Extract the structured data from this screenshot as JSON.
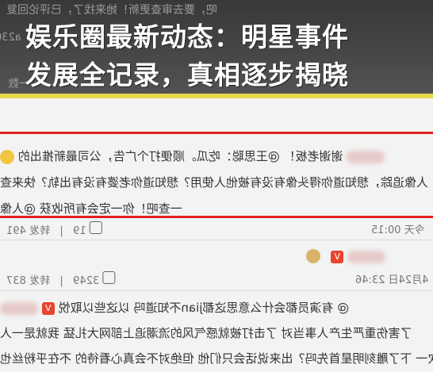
{
  "headline": {
    "line1": "娱乐圈最新动态：明星事件",
    "line2": "发展全记录，真相逐步揭晓"
  },
  "banner_ghost": {
    "top": "吧，要去审查更新！她来找了，已评论回复",
    "mid": "a230",
    "bottom": "一数"
  },
  "comments": {
    "c1_text": "谢谢老板！ @王思聪：吃瓜。顺便打个广告，公司最新推出的",
    "c1_line2": "人像追踪，想知道你得头像有没有被他人使用？想知道你老婆有没有出轨？快来查",
    "c1_line3": "一查吧！你一定会有所收获 @人像",
    "c1_time": "今天 00:15",
    "c1_reposts": "转发 491",
    "c1_likes": "19",
    "c2_time": "4月24日 23:46",
    "c2_reposts": "转发 837",
    "c2_likes": "3249",
    "c3_text": "@ 有演员都会什么意思这都jian不知道吗 以这些以取悦",
    "c3_line2": "了害伤重严生产人事当对 了击打被就感气风的流潮追上部网大扎猛 我就是一人",
    "c3_line3": "次一 下了雕刻明星首先吗？出来说话会只们他 但绝对不会真心看待的 不在乎粉丝也"
  },
  "colors": {
    "accent_red": "#e02020",
    "banner_bg": "#333333",
    "yellow": "#e8d84a"
  }
}
